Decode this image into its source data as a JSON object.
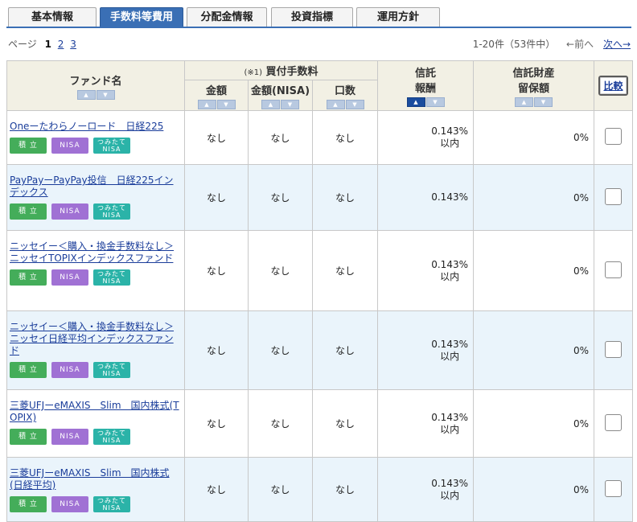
{
  "tabs": [
    {
      "label": "基本情報",
      "active": false
    },
    {
      "label": "手数料等費用",
      "active": true
    },
    {
      "label": "分配金情報",
      "active": false
    },
    {
      "label": "投資指標",
      "active": false
    },
    {
      "label": "運用方針",
      "active": false
    }
  ],
  "pager": {
    "label": "ページ",
    "pages": [
      "1",
      "2",
      "3"
    ],
    "summary": "1-20件（53件中）",
    "prev": "←前へ",
    "next": "次へ→"
  },
  "header": {
    "fund_name": "ファンド名",
    "buy_fee_note": "(※1)",
    "buy_fee": "買付手数料",
    "amount": "金額",
    "amount_nisa": "金額(NISA)",
    "units": "口数",
    "trust_fee_1": "信託",
    "trust_fee_2": "報酬",
    "retained_1": "信託財産",
    "retained_2": "留保額",
    "compare": "比較"
  },
  "badges": {
    "tsumitate": "積 立",
    "nisa": "NISA",
    "tsumitate_nisa_1": "つみたて",
    "tsumitate_nisa_2": "NISA"
  },
  "rows": [
    {
      "name": "Oneーたわらノーロード　日経225",
      "amount": "なし",
      "amount_nisa": "なし",
      "units": "なし",
      "fee": "0.143%",
      "fee_suffix": "以内",
      "retained": "0%"
    },
    {
      "name": "PayPayーPayPay投信　日経225インデックス",
      "amount": "なし",
      "amount_nisa": "なし",
      "units": "なし",
      "fee": "0.143%",
      "fee_suffix": "",
      "retained": "0%"
    },
    {
      "name": "ニッセイー＜購入・換金手数料なし＞ニッセイTOPIXインデックスファンド",
      "amount": "なし",
      "amount_nisa": "なし",
      "units": "なし",
      "fee": "0.143%",
      "fee_suffix": "以内",
      "retained": "0%"
    },
    {
      "name": "ニッセイー＜購入・換金手数料なし＞ニッセイ日経平均インデックスファンド",
      "amount": "なし",
      "amount_nisa": "なし",
      "units": "なし",
      "fee": "0.143%",
      "fee_suffix": "以内",
      "retained": "0%"
    },
    {
      "name": "三菱UFJーeMAXIS　Slim　国内株式(TOPIX)",
      "amount": "なし",
      "amount_nisa": "なし",
      "units": "なし",
      "fee": "0.143%",
      "fee_suffix": "以内",
      "retained": "0%"
    },
    {
      "name": "三菱UFJーeMAXIS　Slim　国内株式(日経平均)",
      "amount": "なし",
      "amount_nisa": "なし",
      "units": "なし",
      "fee": "0.143%",
      "fee_suffix": "以内",
      "retained": "0%"
    }
  ]
}
